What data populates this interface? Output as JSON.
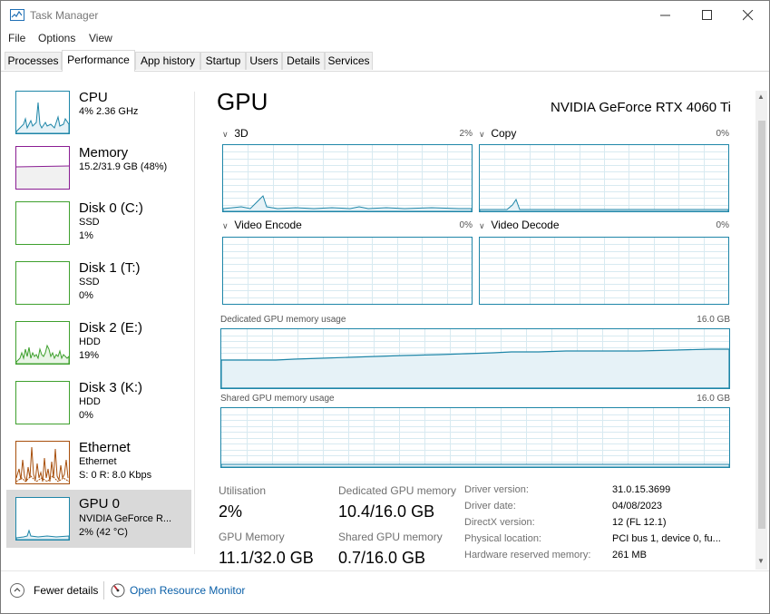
{
  "window": {
    "title": "Task Manager"
  },
  "menu": [
    "File",
    "Options",
    "View"
  ],
  "tabs": [
    "Processes",
    "Performance",
    "App history",
    "Startup",
    "Users",
    "Details",
    "Services"
  ],
  "sidebar": [
    {
      "name": "CPU",
      "lines": [
        "4% 2.36 GHz"
      ],
      "color": "#1e86a8"
    },
    {
      "name": "Memory",
      "lines": [
        "15.2/31.9 GB (48%)"
      ],
      "color": "#8a1d93"
    },
    {
      "name": "Disk 0 (C:)",
      "lines": [
        "SSD",
        "1%"
      ],
      "color": "#3ea02d"
    },
    {
      "name": "Disk 1 (T:)",
      "lines": [
        "SSD",
        "0%"
      ],
      "color": "#3ea02d"
    },
    {
      "name": "Disk 2 (E:)",
      "lines": [
        "HDD",
        "19%"
      ],
      "color": "#3ea02d"
    },
    {
      "name": "Disk 3 (K:)",
      "lines": [
        "HDD",
        "0%"
      ],
      "color": "#3ea02d"
    },
    {
      "name": "Ethernet",
      "lines": [
        "Ethernet",
        "S: 0 R: 8.0 Kbps"
      ],
      "color": "#a74f0c"
    },
    {
      "name": "GPU 0",
      "lines": [
        "NVIDIA GeForce R...",
        "2% (42 °C)"
      ],
      "color": "#1e86a8"
    }
  ],
  "main": {
    "title": "GPU",
    "device": "NVIDIA GeForce RTX 4060 Ti",
    "engines": [
      {
        "label": "3D",
        "pct": "2%"
      },
      {
        "label": "Copy",
        "pct": "0%"
      },
      {
        "label": "Video Encode",
        "pct": "0%"
      },
      {
        "label": "Video Decode",
        "pct": "0%"
      }
    ],
    "dedicated": {
      "label": "Dedicated GPU memory usage",
      "max": "16.0 GB"
    },
    "shared": {
      "label": "Shared GPU memory usage",
      "max": "16.0 GB"
    }
  },
  "stats": {
    "utilisation_label": "Utilisation",
    "utilisation": "2%",
    "dedicated_label": "Dedicated GPU memory",
    "dedicated": "10.4/16.0 GB",
    "gpu_memory_label": "GPU Memory",
    "gpu_memory": "11.1/32.0 GB",
    "shared_label": "Shared GPU memory",
    "shared": "0.7/16.0 GB"
  },
  "details": [
    {
      "key": "Driver version:",
      "value": "31.0.15.3699"
    },
    {
      "key": "Driver date:",
      "value": "04/08/2023"
    },
    {
      "key": "DirectX version:",
      "value": "12 (FL 12.1)"
    },
    {
      "key": "Physical location:",
      "value": "PCI bus 1, device 0, fu..."
    },
    {
      "key": "Hardware reserved memory:",
      "value": "261 MB"
    }
  ],
  "footer": {
    "fewer": "Fewer details",
    "resource": "Open Resource Monitor"
  },
  "colors": {
    "gpu_line": "#1e86a8",
    "graph_grid": "#d8eaf1",
    "link": "#0a5fa8"
  }
}
